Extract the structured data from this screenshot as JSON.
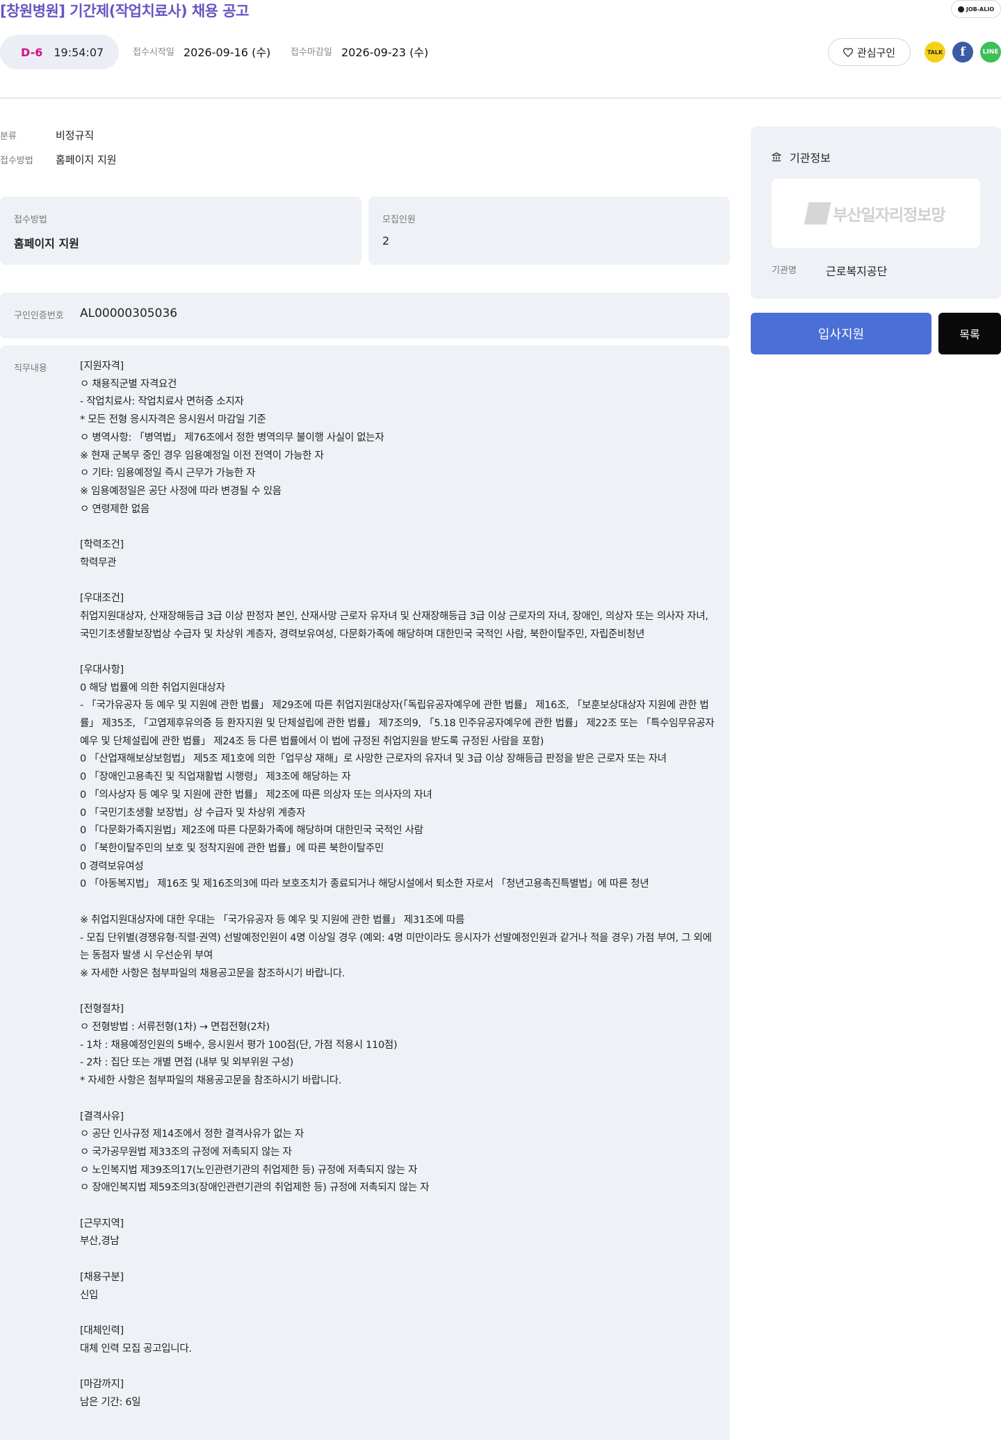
{
  "header": {
    "title": "[창원병원] 기간제(작업치료사) 채용 공고",
    "badge": "JOB-ALIO"
  },
  "deadline": {
    "d_label": "D-6",
    "countdown": "19:54:07",
    "start_label": "접수시작일",
    "start_value": "2026-09-16 (수)",
    "end_label": "접수마감일",
    "end_value": "2026-09-23 (수)"
  },
  "actions": {
    "favorite_label": "관심구인",
    "kakao_text": "TALK",
    "facebook_text": "f",
    "line_text": "LINE"
  },
  "summary": [
    {
      "label": "분류",
      "value": "비정규직"
    },
    {
      "label": "접수방법",
      "value": "홈페이지 지원"
    }
  ],
  "cards": {
    "method_label": "접수방법",
    "method_value": "홈페이지 지원",
    "count_label": "모집인원",
    "count_value": "2"
  },
  "cert": {
    "label": "구인인증번호",
    "value": "AL00000305036"
  },
  "job": {
    "label": "직무내용",
    "content": "[지원자격]\nㅇ 채용직군별 자격요건\n- 작업치료사: 작업치료사 면허증 소지자\n* 모든 전형 응시자격은 응시원서 마감일 기준\nㅇ 병역사항: 「병역법」 제76조에서 정한 병역의무 불이행 사실이 없는자\n※ 현재 군복무 중인 경우 임용예정일 이전 전역이 가능한 자\nㅇ 기타: 임용예정일 즉시 근무가 가능한 자\n※ 임용예정일은 공단 사정에 따라 변경될 수 있음\nㅇ 연령제한 없음\n\n[학력조건]\n학력무관\n\n[우대조건]\n취업지원대상자, 산재장해등급 3급 이상 판정자 본인, 산재사망 근로자 유자녀 및 산재장해등급 3급 이상 근로자의 자녀, 장애인, 의상자 또는 의사자 자녀, 국민기초생활보장법상 수급자 및 차상위 계층자, 경력보유여성, 다문화가족에 해당하며 대한민국 국적인 사람, 북한이탈주민, 자립준비청년\n\n[우대사항]\n0 해당 법률에 의한 취업지원대상자\n- 「국가유공자 등 예우 및 지원에 관한 법률」 제29조에 따른 취업지원대상자(「독립유공자예우에 관한 법률」 제16조, 「보훈보상대상자 지원에 관한 법률」 제35조, 「고엽제후유의증 등 환자지원 및 단체설립에 관한 법률」 제7조의9, 「5.18 민주유공자예우에 관한 법률」 제22조 또는 「특수임무유공자 예우 및 단체설립에 관한 법률」 제24조 등 다른 법률에서 이 법에 규정된 취업지원을 받도록 규정된 사람을 포함)\n0 「산업재해보상보험법」 제5조 제1호에 의한「업무상 재해」로 사망한 근로자의 유자녀 및 3급 이상 장해등급 판정을 받은 근로자 또는 자녀\n0 「장애인고용촉진 및 직업재활법 시행령」 제3조에 해당하는 자\n0 「의사상자 등 예우 및 지원에 관한 법률」 제2조에 따른 의상자 또는 의사자의 자녀\n0 「국민기초생활 보장법」상 수급자 및 차상위 계층자\n0 「다문화가족지원법」제2조에 따른 다문화가족에 해당하며 대한민국 국적인 사람\n0 「북한이탈주민의 보호 및 정착지원에 관한 법률」에 따른 북한이탈주민\n0 경력보유여성\n0 「아동복지법」 제16조 및 제16조의3에 따라 보호조치가 종료되거나 해당시설에서 퇴소한 자로서 「청년고용촉진특별법」에 따른 청년\n\n※ 취업지원대상자에 대한 우대는 「국가유공자 등 예우 및 지원에 관한 법률」 제31조에 따름\n- 모집 단위별(경쟁유형·직렬·권역) 선발예정인원이 4명 이상일 경우 (예외: 4명 미만이라도 응시자가 선발예정인원과 같거나 적을 경우) 가점 부여, 그 외에는 동점자 발생 시 우선순위 부여\n※ 자세한 사항은 첨부파일의 채용공고문을 참조하시기 바랍니다.\n\n[전형절차]\nㅇ 전형방법 : 서류전형(1차) → 면접전형(2차)\n- 1차 : 채용예정인원의 5배수, 응시원서 평가 100점(단, 가점 적용시 110점)\n- 2차 : 집단 또는 개별 면접 (내부 및 외부위원 구성)\n* 자세한 사항은 첨부파일의 채용공고문을 참조하시기 바랍니다.\n\n[결격사유]\nㅇ 공단 인사규정 제14조에서 정한 결격사유가 없는 자\nㅇ 국가공무원법 제33조의 규정에 저촉되지 않는 자\nㅇ 노인복지법 제39조의17(노인관련기관의 취업제한 등) 규정에 저촉되지 않는 자\nㅇ 장애인복지법 제59조의3(장애인관련기관의 취업제한 등) 규정에 저촉되지 않는 자\n\n[근무지역]\n부산,경남\n\n[채용구분]\n신입\n\n[대체인력]\n대체 인력 모집 공고입니다.\n\n[마감까지]\n남은 기간: 6일"
  },
  "sidebar": {
    "heading": "기관정보",
    "logo_text": "부산일자리정보망",
    "org_label": "기관명",
    "org_value": "근로복지공단",
    "apply_label": "입사지원",
    "list_label": "목록"
  },
  "colors": {
    "title": "#6a53c4",
    "d_day": "#d2127e",
    "apply": "#4a6fd6",
    "panel": "#eef1f6"
  }
}
